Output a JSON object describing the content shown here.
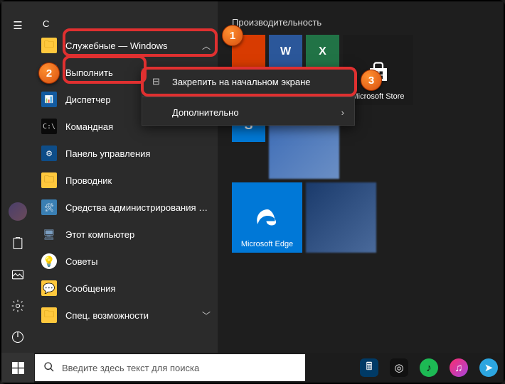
{
  "letter_heading": "С",
  "apps": {
    "system_folder": "Служебные — Windows",
    "run": "Выполнить",
    "task_manager": "Диспетчер",
    "cmd": "Командная",
    "control_panel": "Панель управления",
    "explorer": "Проводник",
    "admin_tools": "Средства администрирования Wi...",
    "this_pc": "Этот компьютер",
    "tips": "Советы",
    "messages": "Сообщения",
    "accessibility": "Спец. возможности"
  },
  "context_menu": {
    "pin_start": "Закрепить на начальном экране",
    "more": "Дополнительно"
  },
  "tiles": {
    "group_title": "Производительность",
    "store": "Microsoft Store",
    "edge": "Microsoft Edge"
  },
  "taskbar": {
    "search_placeholder": "Введите здесь текст для поиска"
  },
  "badges": {
    "one": "1",
    "two": "2",
    "three": "3"
  }
}
